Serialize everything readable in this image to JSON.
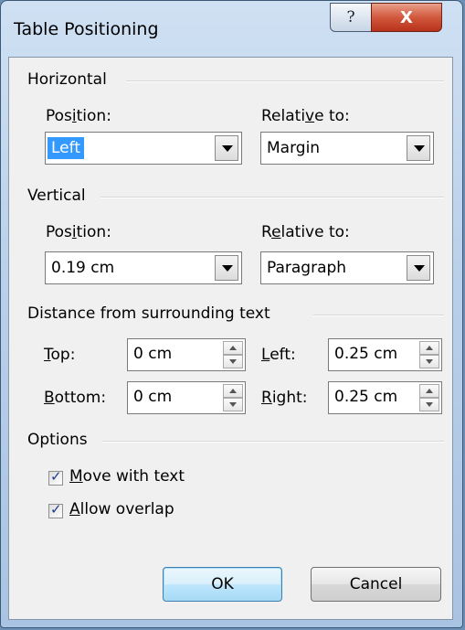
{
  "window": {
    "title": "Table Positioning"
  },
  "titlebar": {
    "help_glyph": "?",
    "close_glyph": "X"
  },
  "horizontal": {
    "group_label": "Horizontal",
    "position_label_pre": "Pos",
    "position_label_u": "i",
    "position_label_post": "tion:",
    "position_value": "Left",
    "relative_label_pre": "Relati",
    "relative_label_u": "v",
    "relative_label_post": "e to:",
    "relative_value": "Margin"
  },
  "vertical": {
    "group_label": "Vertical",
    "position_label_pre": "Pos",
    "position_label_u": "i",
    "position_label_post": "tion:",
    "position_value": "0.19 cm",
    "relative_label_pre": "R",
    "relative_label_u": "e",
    "relative_label_post": "lative to:",
    "relative_value": "Paragraph"
  },
  "distance": {
    "group_label": "Distance from surrounding text",
    "top_label_u": "T",
    "top_label_post": "op:",
    "top_value": "0 cm",
    "bottom_label_u": "B",
    "bottom_label_post": "ottom:",
    "bottom_value": "0 cm",
    "left_label_u": "L",
    "left_label_post": "eft:",
    "left_value": "0.25 cm",
    "right_label_u": "R",
    "right_label_post": "ight:",
    "right_value": "0.25 cm"
  },
  "options": {
    "group_label": "Options",
    "move_with_text_u": "M",
    "move_with_text_post": "ove with text",
    "move_with_text_checked": true,
    "allow_overlap_u": "A",
    "allow_overlap_post": "llow overlap",
    "allow_overlap_checked": true
  },
  "buttons": {
    "ok": "OK",
    "cancel": "Cancel"
  },
  "colors": {
    "selection": "#3399ff",
    "close_button": "#c8442a"
  }
}
